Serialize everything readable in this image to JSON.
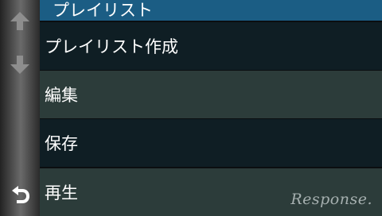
{
  "screen": {
    "title": "プレイリスト"
  },
  "side_controls": {
    "up_icon": "arrow-up-icon",
    "down_icon": "arrow-down-icon",
    "back_icon": "back-arrow-icon"
  },
  "menu": {
    "items": [
      {
        "label": "プレイリスト作成"
      },
      {
        "label": "編集"
      },
      {
        "label": "保存"
      },
      {
        "label": "再生"
      }
    ]
  },
  "watermark": {
    "text": "Response."
  },
  "colors": {
    "header_bg": "#1b5d84",
    "row_dark": "#0f1e24",
    "row_light": "#2c3c3a",
    "text": "#ffffff"
  }
}
